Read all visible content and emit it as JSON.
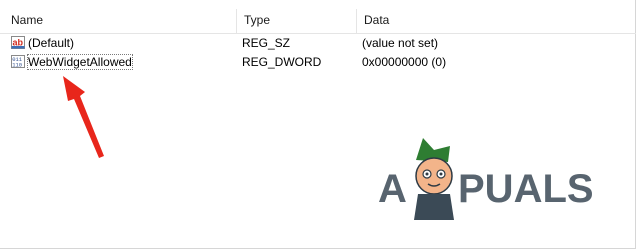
{
  "columns": {
    "name": "Name",
    "type": "Type",
    "data": "Data"
  },
  "rows": [
    {
      "icon": "string-value-icon",
      "name": "(Default)",
      "type": "REG_SZ",
      "data": "(value not set)"
    },
    {
      "icon": "binary-value-icon",
      "name": "WebWidgetAllowed",
      "type": "REG_DWORD",
      "data": "0x00000000 (0)"
    }
  ],
  "annotation": {
    "icon": "red-arrow-icon",
    "color": "#e8261b"
  },
  "watermark": {
    "text_left": "A",
    "text_right": "PUALS",
    "logo": "appuals-mascot-logo",
    "color": "#3b4a56"
  }
}
